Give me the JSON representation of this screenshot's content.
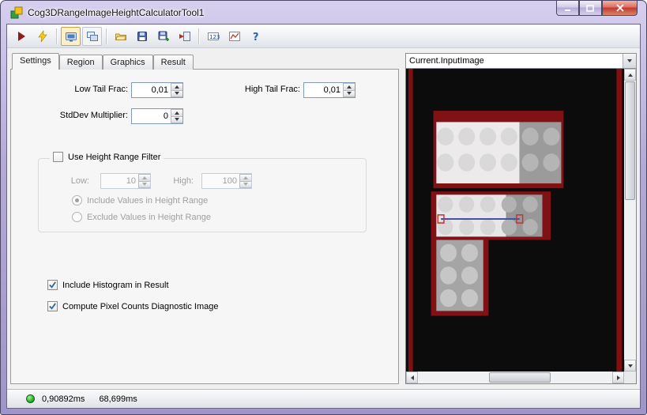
{
  "window": {
    "title": "Cog3DRangeImageHeightCalculatorTool1"
  },
  "toolbar": {
    "buttons": [
      {
        "name": "run-button",
        "icon": "play-icon"
      },
      {
        "name": "electric-run-button",
        "icon": "lightning-icon"
      },
      {
        "name": "display-toggle-button",
        "icon": "monitor-icon",
        "pressed": true
      },
      {
        "name": "buffer-toggle-button",
        "icon": "monitor-stack-icon",
        "pressed": false
      },
      {
        "name": "open-button",
        "icon": "open-folder-icon"
      },
      {
        "name": "save-button",
        "icon": "floppy-icon"
      },
      {
        "name": "save-results-button",
        "icon": "floppy-plus-icon"
      },
      {
        "name": "import-button",
        "icon": "import-icon"
      },
      {
        "name": "expression-button",
        "icon": "calculator-123-icon"
      },
      {
        "name": "graph-button",
        "icon": "graph-icon"
      },
      {
        "name": "help-button",
        "icon": "help-icon"
      }
    ]
  },
  "tabs": [
    {
      "label": "Settings",
      "active": true
    },
    {
      "label": "Region",
      "active": false
    },
    {
      "label": "Graphics",
      "active": false
    },
    {
      "label": "Result",
      "active": false
    }
  ],
  "settings": {
    "low_tail_frac_label": "Low Tail Frac:",
    "low_tail_frac_value": "0,01",
    "high_tail_frac_label": "High Tail Frac:",
    "high_tail_frac_value": "0,01",
    "stddev_multiplier_label": "StdDev Multiplier:",
    "stddev_multiplier_value": "0",
    "use_height_range_label": "Use Height Range Filter",
    "use_height_range_checked": false,
    "low_label": "Low:",
    "low_value": "10",
    "high_label": "High:",
    "high_value": "100",
    "include_values_label": "Include Values in Height Range",
    "exclude_values_label": "Exclude Values in Height Range",
    "include_histogram_label": "Include Histogram in Result",
    "include_histogram_checked": true,
    "compute_pixel_counts_label": "Compute Pixel Counts Diagnostic Image",
    "compute_pixel_counts_checked": true
  },
  "image_panel": {
    "source_selector": "Current.InputImage"
  },
  "status_bar": {
    "tool_time": "0,90892ms",
    "total_time": "68,699ms"
  },
  "colors": {
    "overlay_red": "#7c1013",
    "viewer_background": "#0c0c0c",
    "status_indicator": "#1ca81c",
    "marker_blue": "#4053a8"
  }
}
